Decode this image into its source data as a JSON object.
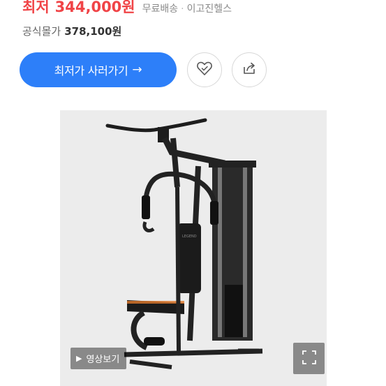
{
  "price": {
    "label": "최저",
    "value": "344,000원",
    "shipping": "무료배송",
    "separator": "·",
    "seller": "이고진헬스"
  },
  "official": {
    "label": "공식몰가",
    "price": "378,100원"
  },
  "buy_button": {
    "label": "최저가 사러가기",
    "arrow": "→"
  },
  "icons": {
    "like": "heart-icon",
    "share": "share-icon",
    "play": "play-icon",
    "expand": "expand-icon"
  },
  "media": {
    "video_label": "영상보기",
    "play_glyph": "▶"
  },
  "colors": {
    "price": "#f04447",
    "accent": "#2d7ff9"
  }
}
